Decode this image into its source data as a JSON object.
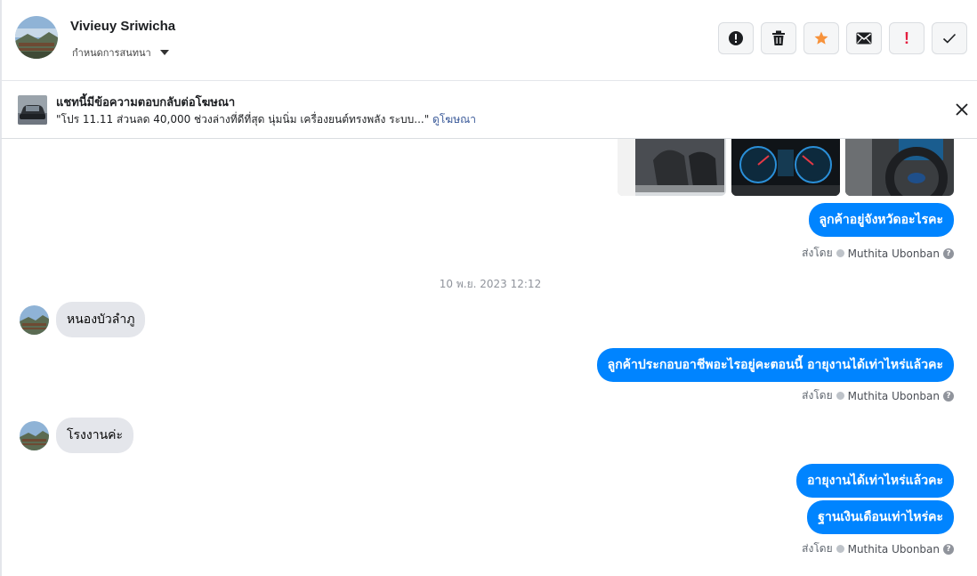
{
  "header": {
    "contact_name": "Vivieuy Sriwicha",
    "assign_label": "กำหนดการสนทนา",
    "actions": [
      {
        "name": "report-button",
        "icon": "alert-circle-icon"
      },
      {
        "name": "delete-button",
        "icon": "trash-icon"
      },
      {
        "name": "star-button",
        "icon": "star-icon"
      },
      {
        "name": "mark-unread-button",
        "icon": "envelope-icon"
      },
      {
        "name": "important-button",
        "icon": "exclamation-icon"
      },
      {
        "name": "mark-done-button",
        "icon": "checkmark-icon"
      }
    ]
  },
  "ad_banner": {
    "title": "แชทนี้มีข้อความตอบกลับต่อโฆษณา",
    "text": "\"โปร 11.11 ส่วนลด 40,000 ช่วงล่างที่ดีที่สุด นุ่มนิ่ม เครื่องยนต์ทรงพลัง ระบบ...\" ",
    "link": "ดูโฆษณา"
  },
  "messages": {
    "out_1": "ลูกค้าอยู่จังหวัดอะไรคะ",
    "timestamp": "10 พ.ย. 2023 12:12",
    "in_1": "หนองบัวลำภู",
    "out_2": "ลูกค้าประกอบอาชีพอะไรอยู่คะตอนนี้ อายุงานได้เท่าไหร่แล้วคะ",
    "in_2": "โรงงานค่ะ",
    "out_3": "อายุงานได้เท่าไหร่แล้วคะ",
    "out_4": "ฐานเงินเดือนเท่าไหร่คะ"
  },
  "sent_by": {
    "prefix": "ส่งโดย",
    "agent": "Muthita Ubonban",
    "help": "?"
  },
  "colors": {
    "bubble_out": "#0084ff",
    "bubble_in": "#e4e6eb",
    "star": "#f7923b",
    "important": "#e41e3f"
  }
}
